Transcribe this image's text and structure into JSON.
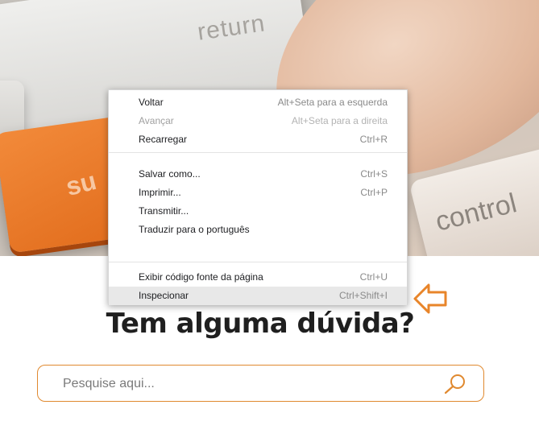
{
  "page": {
    "heading": "Tem alguma dúvida?"
  },
  "hero": {
    "key_return": "return",
    "key_orange": "su",
    "key_control": "control"
  },
  "context_menu": {
    "items": [
      {
        "label": "Voltar",
        "shortcut": "Alt+Seta para a esquerda",
        "disabled": false
      },
      {
        "label": "Avançar",
        "shortcut": "Alt+Seta para a direita",
        "disabled": true
      },
      {
        "label": "Recarregar",
        "shortcut": "Ctrl+R",
        "disabled": false
      },
      {
        "label": "Salvar como...",
        "shortcut": "Ctrl+S",
        "disabled": false
      },
      {
        "label": "Imprimir...",
        "shortcut": "Ctrl+P",
        "disabled": false
      },
      {
        "label": "Transmitir...",
        "shortcut": "",
        "disabled": false
      },
      {
        "label": "Traduzir para o português",
        "shortcut": "",
        "disabled": false
      },
      {
        "label": "Exibir código fonte da página",
        "shortcut": "Ctrl+U",
        "disabled": false
      },
      {
        "label": "Inspecionar",
        "shortcut": "Ctrl+Shift+I",
        "disabled": false,
        "highlighted": true
      }
    ]
  },
  "search": {
    "placeholder": "Pesquise aqui...",
    "value": ""
  },
  "colors": {
    "accent": "#e0892f",
    "arrow": "#e8852a"
  },
  "icons": {
    "search": "search-icon",
    "pointer_arrow": "arrow-left-icon"
  }
}
